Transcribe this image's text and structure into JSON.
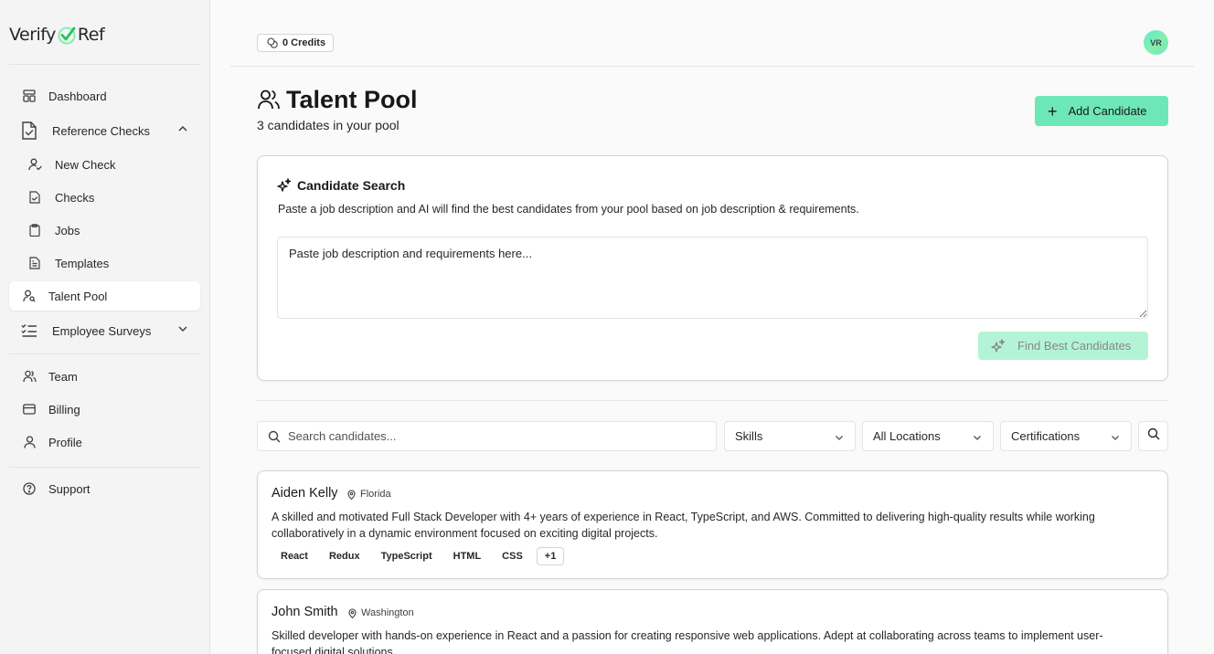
{
  "logo": {
    "left": "Verify",
    "right": "Ref"
  },
  "sidebar": {
    "items": [
      {
        "label": "Dashboard"
      },
      {
        "label": "Reference Checks"
      },
      {
        "label": "New Check"
      },
      {
        "label": "Checks"
      },
      {
        "label": "Jobs"
      },
      {
        "label": "Templates"
      },
      {
        "label": "Talent Pool"
      },
      {
        "label": "Employee Surveys"
      },
      {
        "label": "Team"
      },
      {
        "label": "Billing"
      },
      {
        "label": "Profile"
      },
      {
        "label": "Support"
      }
    ],
    "active": "Talent Pool"
  },
  "topbar": {
    "credits": "0 Credits",
    "avatar_initials": "VR"
  },
  "header": {
    "title": "Talent Pool",
    "subtitle": "3 candidates in your pool",
    "add_button": "Add Candidate"
  },
  "ai_search": {
    "title": "Candidate Search",
    "description": "Paste a job description and AI will find the best candidates from your pool based on job description & requirements.",
    "placeholder": "Paste job description and requirements here...",
    "button": "Find Best Candidates"
  },
  "filters": {
    "search_placeholder": "Search candidates...",
    "skills": "Skills",
    "locations": "All Locations",
    "certifications": "Certifications"
  },
  "candidates": [
    {
      "name": "Aiden Kelly",
      "location": "Florida",
      "bio": "A skilled and motivated Full Stack Developer with 4+ years of experience in React, TypeScript, and AWS. Committed to delivering high-quality results while working collaboratively in a dynamic environment focused on exciting digital projects.",
      "tags": [
        "React",
        "Redux",
        "TypeScript",
        "HTML",
        "CSS"
      ],
      "more": "+1"
    },
    {
      "name": "John Smith",
      "location": "Washington",
      "bio": "Skilled developer with hands-on experience in React and a passion for creating responsive web applications. Adept at collaborating across teams to implement user-focused digital solutions."
    }
  ],
  "colors": {
    "accent": "#6ee7b7",
    "accent_disabled": "#a7f3d0",
    "check_icon": "#34d399"
  }
}
